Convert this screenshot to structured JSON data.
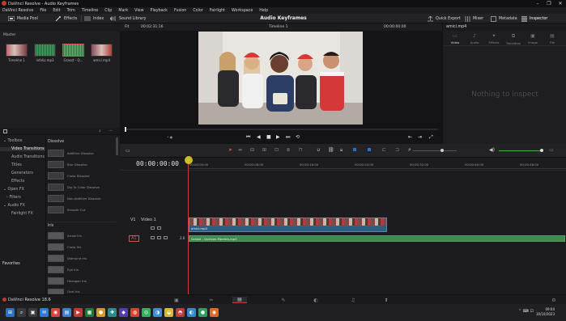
{
  "window": {
    "title": "DaVinci Resolve - Audio Keyframes",
    "controls": [
      "–",
      "❐",
      "✕"
    ]
  },
  "menu": [
    "DaVinci Resolve",
    "File",
    "Edit",
    "Trim",
    "Timeline",
    "Clip",
    "Mark",
    "View",
    "Playback",
    "Fusion",
    "Color",
    "Fairlight",
    "Workspace",
    "Help"
  ],
  "toolbar": {
    "media_pool": "Media Pool",
    "effects": "Effects",
    "index": "Index",
    "sound_library": "Sound Library",
    "project_title": "Audio Keyframes",
    "quick_export": "Quick Export",
    "mixer": "Mixer",
    "metadata": "Metadata",
    "inspector": "Inspector"
  },
  "media_pool": {
    "bin": "Master",
    "clips": [
      {
        "name": "Timeline 1",
        "color": "#8b4a52"
      },
      {
        "name": "infeliz.mp3",
        "color": "#2f5a3a"
      },
      {
        "name": "Grasst - Q...",
        "color": "#3a6a3a"
      },
      {
        "name": "amici.mp4",
        "color": "#7a4a5a"
      }
    ]
  },
  "viewer": {
    "zoom": "Fit",
    "timecode_left": "00:02:31:16",
    "timeline_name": "Timeline 1",
    "timecode_right": "00:00:00:00",
    "dots": "• ●"
  },
  "inspector": {
    "clip_name": "amici.mp4",
    "tabs": [
      "Video",
      "Audio",
      "Effects",
      "Transition",
      "Image",
      "File"
    ],
    "empty_message": "Nothing to inspect"
  },
  "effects": {
    "tree": [
      {
        "label": "Toolbox",
        "selected": false
      },
      {
        "label": "Video Transitions",
        "selected": true
      },
      {
        "label": "Audio Transitions",
        "selected": false
      },
      {
        "label": "Titles",
        "selected": false
      },
      {
        "label": "Generators",
        "selected": false
      },
      {
        "label": "Effects",
        "selected": false
      },
      {
        "label": "Open FX",
        "selected": false
      },
      {
        "label": "Filters",
        "selected": false
      },
      {
        "label": "Audio FX",
        "selected": false
      },
      {
        "label": "Fairlight FX",
        "selected": false
      }
    ],
    "dissolve_header": "Dissolve",
    "dissolve_items": [
      "Additive Dissolve",
      "Blur Dissolve",
      "Cross Dissolve",
      "Dip To Color Dissolve",
      "Non-Additive Dissolve",
      "Smooth Cut"
    ],
    "iris_header": "Iris",
    "iris_items": [
      "Arrow Iris",
      "Cross Iris",
      "Diamond Iris",
      "Eye Iris",
      "Hexagon Iris",
      "Oval Iris"
    ],
    "favorites": "Favorites"
  },
  "timeline": {
    "timecode": "00:00:00:00",
    "ruler": [
      "00:00:00:00",
      "00:00:08:00",
      "00:00:16:00",
      "00:00:24:00",
      "00:00:32:00",
      "00:00:40:00",
      "00:00:48:00"
    ],
    "v1": {
      "id": "V1",
      "name": "Video 1",
      "clip": "amici.mp4"
    },
    "a1": {
      "id": "A1",
      "level": "2.0",
      "clip": "Grasst - Quincas Moreira.mp3"
    }
  },
  "pagenav": {
    "brand": "DaVinci Resolve 18.6"
  },
  "taskbar": {
    "apps": [
      {
        "icon": "⊞",
        "color": "#2a6fd6"
      },
      {
        "icon": "⌕",
        "color": "#3a3a40"
      },
      {
        "icon": "▣",
        "color": "#3a3a40"
      },
      {
        "icon": "✉",
        "color": "#2b7bd8"
      },
      {
        "icon": "◉",
        "color": "#d9423a"
      },
      {
        "icon": "▤",
        "color": "#3c7fd0"
      },
      {
        "icon": "▶",
        "color": "#c33"
      },
      {
        "icon": "▦",
        "color": "#1f7a3a"
      },
      {
        "icon": "●",
        "color": "#d59a20"
      },
      {
        "icon": "✚",
        "color": "#2a8d8d"
      },
      {
        "icon": "◆",
        "color": "#5b3bb0"
      },
      {
        "icon": "◍",
        "color": "#d6442e"
      },
      {
        "icon": "◎",
        "color": "#2db35a"
      },
      {
        "icon": "◑",
        "color": "#3a8edc"
      },
      {
        "icon": "◒",
        "color": "#d6b82e"
      },
      {
        "icon": "◓",
        "color": "#c03a3a"
      },
      {
        "icon": "◐",
        "color": "#2d8bd0"
      },
      {
        "icon": "●",
        "color": "#29a35a"
      },
      {
        "icon": "◉",
        "color": "#e0682a"
      }
    ],
    "time": "09:04",
    "date": "30/10/2023"
  }
}
